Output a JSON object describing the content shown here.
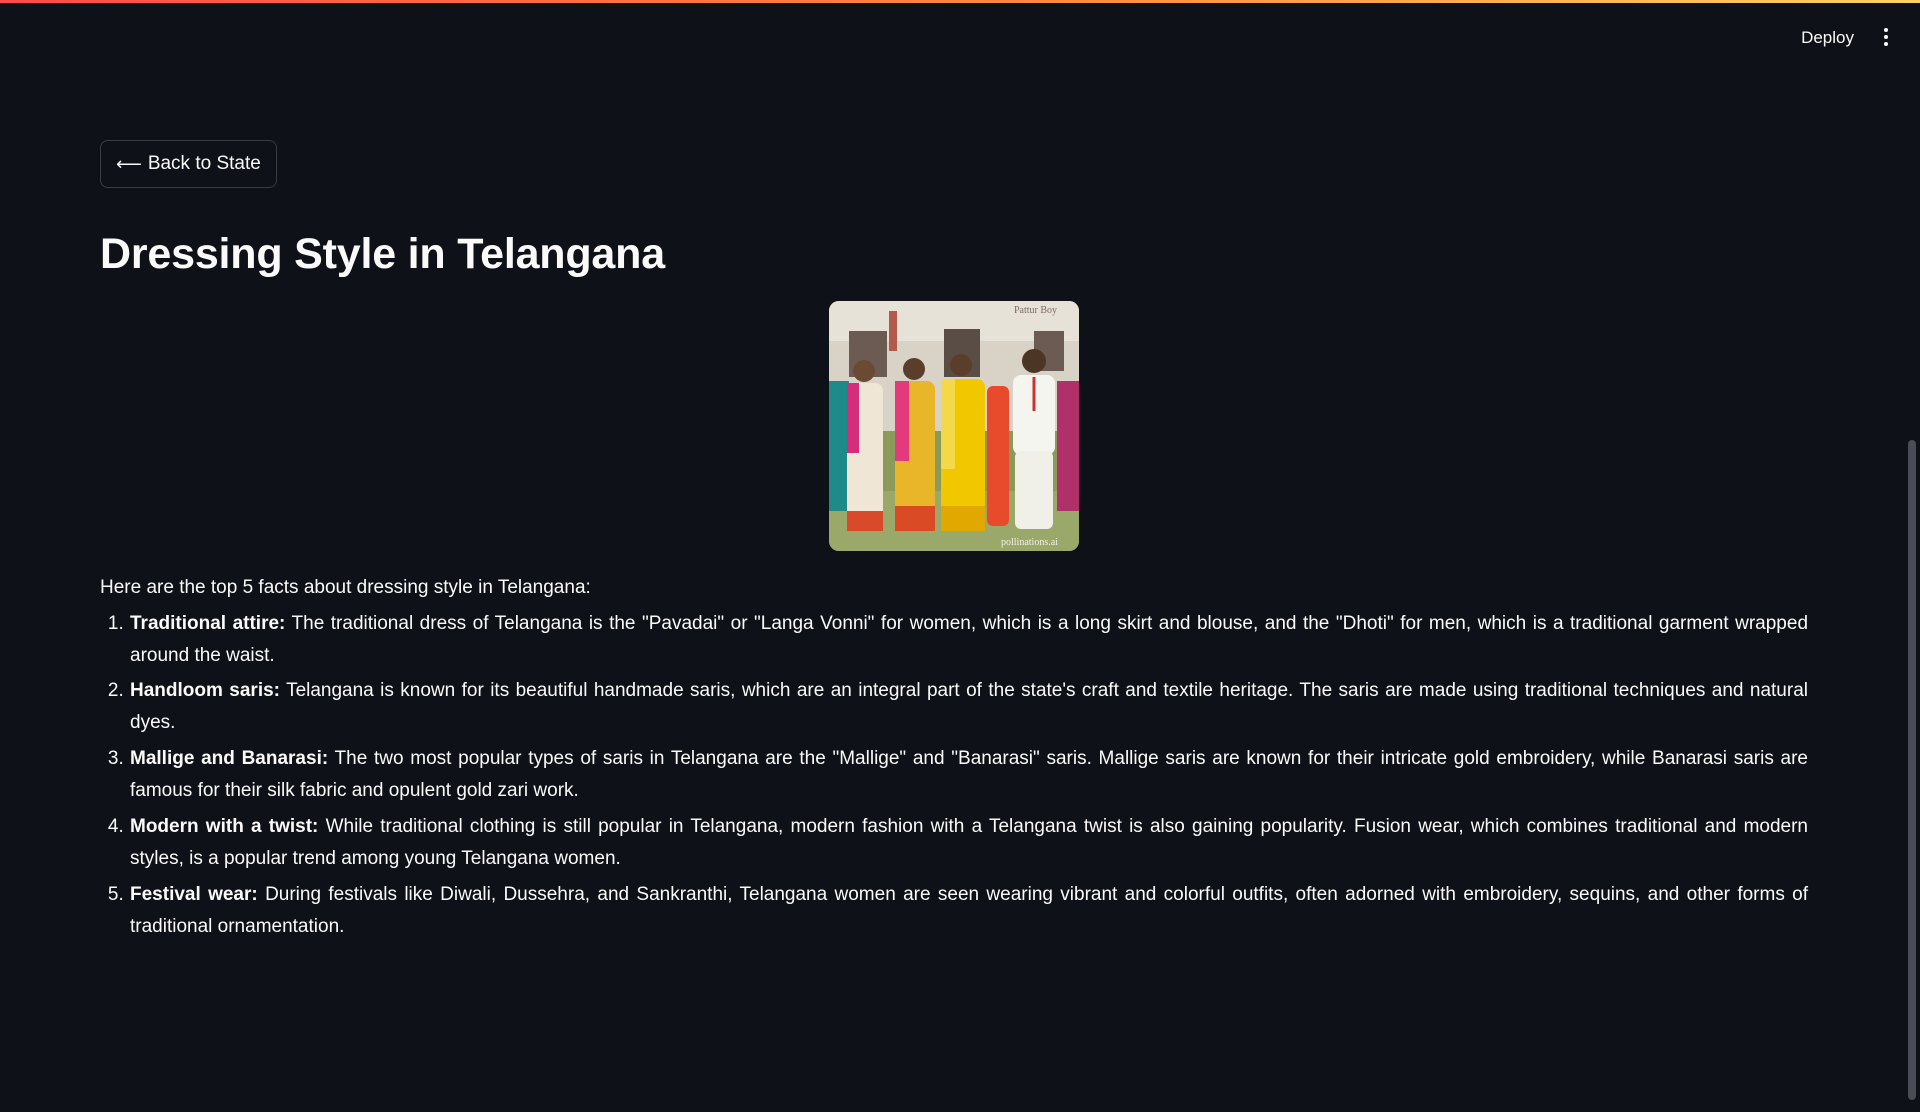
{
  "header": {
    "deploy_label": "Deploy",
    "menu_icon": "more-vertical-icon"
  },
  "main": {
    "back_button": {
      "icon": "arrow-left-icon",
      "label": "Back to State"
    },
    "title": "Dressing Style in Telangana",
    "image": {
      "sign_text": "Pattur Boy",
      "watermark": "pollinations.ai"
    },
    "intro": "Here are the top 5 facts about dressing style in Telangana:",
    "facts": [
      {
        "number": "1.",
        "heading": "Traditional attire:",
        "text": " The traditional dress of Telangana is the \"Pavadai\" or \"Langa Vonni\" for women, which is a long skirt and blouse, and the \"Dhoti\" for men, which is a traditional garment wrapped around the waist."
      },
      {
        "number": "2.",
        "heading": "Handloom saris:",
        "text": " Telangana is known for its beautiful handmade saris, which are an integral part of the state's craft and textile heritage. The saris are made using traditional techniques and natural dyes."
      },
      {
        "number": "3.",
        "heading": "Mallige and Banarasi:",
        "text": " The two most popular types of saris in Telangana are the \"Mallige\" and \"Banarasi\" saris. Mallige saris are known for their intricate gold embroidery, while Banarasi saris are famous for their silk fabric and opulent gold zari work."
      },
      {
        "number": "4.",
        "heading": "Modern with a twist:",
        "text": " While traditional clothing is still popular in Telangana, modern fashion with a Telangana twist is also gaining popularity. Fusion wear, which combines traditional and modern styles, is a popular trend among young Telangana women."
      },
      {
        "number": "5.",
        "heading": "Festival wear:",
        "text": " During festivals like Diwali, Dussehra, and Sankranthi, Telangana women are seen wearing vibrant and colorful outfits, often adorned with embroidery, sequins, and other forms of traditional ornamentation."
      }
    ]
  },
  "colors": {
    "background": "#0e1117",
    "text": "#fafafa",
    "accent_gradient_start": "#ff4b4b",
    "accent_gradient_end": "#ffd166",
    "button_border": "#3a3d47"
  }
}
